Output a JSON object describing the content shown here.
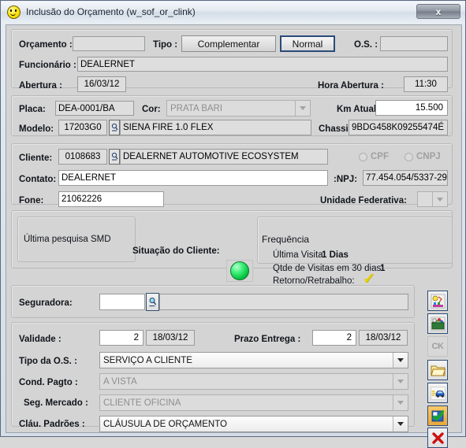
{
  "window": {
    "title": "Inclusão do Orçamento (w_sof_or_clink)",
    "app_icon": "smiley-face-icon",
    "close_label": "x"
  },
  "form": {
    "orcamento": {
      "label": "Orçamento :",
      "value": ""
    },
    "tipo": {
      "label": "Tipo :",
      "options": [
        "Complementar",
        "Normal"
      ],
      "selected": "Normal"
    },
    "os": {
      "label": "O.S. :",
      "value": ""
    },
    "funcionario": {
      "label": "Funcionário :",
      "value": "DEALERNET"
    },
    "abertura": {
      "label": "Abertura :",
      "value": "16/03/12"
    },
    "hora_abertura": {
      "label": "Hora Abertura :",
      "value": "11:30"
    },
    "placa": {
      "label": "Placa:",
      "value": "DEA-0001/BA"
    },
    "cor": {
      "label": "Cor:",
      "value": "PRATA BARI"
    },
    "km_atual": {
      "label": "Km Atual",
      "value": "15.500"
    },
    "modelo": {
      "label": "Modelo:",
      "code": "17203G0",
      "value": "SIENA FIRE 1.0 FLEX",
      "search_icon": "search-icon"
    },
    "chassi": {
      "label": "Chassi:",
      "value": "9BDG458K09255474É"
    },
    "cliente": {
      "label": "Cliente:",
      "code": "0108683",
      "value": "DEALERNET AUTOMOTIVE ECOSYSTEM",
      "search_icon": "search-icon"
    },
    "cpf_radio": {
      "label": "CPF"
    },
    "cnpj_radio": {
      "label": "CNPJ"
    },
    "contato": {
      "label": "Contato:",
      "value": "DEALERNET"
    },
    "cnpj": {
      "label": ":NPJ:",
      "value": "77.454.054/5337-29"
    },
    "fone": {
      "label": "Fone:",
      "value": "21062226"
    },
    "unidade_federativa": {
      "label": "Unidade Federativa:",
      "value": ""
    }
  },
  "status_panel": {
    "ultima_pesquisa": "Última pesquisa SMD",
    "situacao_label": "Situação do Cliente:",
    "situacao_color": "#12c43f",
    "frequencia_title": "Frequência",
    "ultima_visita_label": "Última Visita:",
    "ultima_visita_value": "1 Dias",
    "qtde_visitas_label": "Qtde de Visitas em 30 dias:",
    "qtde_visitas_value": "1",
    "retorno_label": "Retorno/Retrabalho:",
    "retorno_mark": "✓"
  },
  "lower": {
    "seguradora": {
      "label": "Seguradora:",
      "value": "",
      "desc": "",
      "search_icon": "search-icon"
    },
    "validade": {
      "label": "Validade :",
      "days": "2",
      "date": "18/03/12"
    },
    "prazo_entrega": {
      "label": "Prazo Entrega :",
      "days": "2",
      "date": "18/03/12"
    },
    "tipo_os": {
      "label": "Tipo da O.S. :",
      "value": "SERVIÇO A CLIENTE"
    },
    "cond_pagto": {
      "label": "Cond. Pagto :",
      "value": "A VISTA"
    },
    "seg_mercado": {
      "label": "Seg. Mercado :",
      "value": "CLIENTE OFICINA"
    },
    "clau_padroes": {
      "label": "Cláu. Padrões :",
      "value": "CLÁUSULA DE ORÇAMENTO"
    }
  },
  "toolbar": {
    "buttons": [
      {
        "name": "paint-palette-icon",
        "label": ""
      },
      {
        "name": "archive-box-icon",
        "label": ""
      },
      {
        "name": "ck-text-icon",
        "label": "CK"
      },
      {
        "name": "open-folder-icon",
        "label": ""
      },
      {
        "name": "car-icon",
        "label": ""
      },
      {
        "name": "confirm-check-icon",
        "label": ""
      },
      {
        "name": "cancel-x-icon",
        "label": ""
      }
    ]
  }
}
